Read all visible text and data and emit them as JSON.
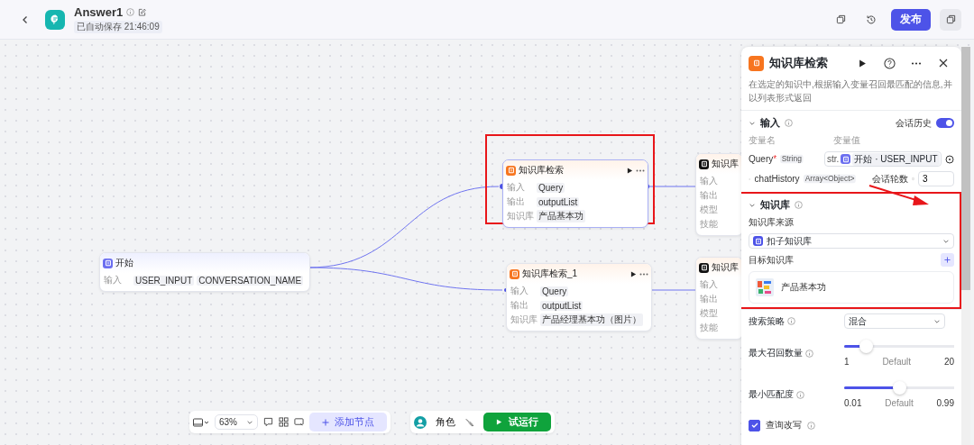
{
  "header": {
    "title": "Answer1",
    "save_status": "已自动保存 21:46:09",
    "publish": "发布"
  },
  "canvas": {
    "nodes": [
      {
        "kind": "start",
        "title": "开始",
        "highlighted": false,
        "rows": [
          {
            "label": "输入",
            "values": [
              "USER_INPUT",
              "CONVERSATION_NAME"
            ]
          }
        ]
      },
      {
        "kind": "knowledge",
        "title": "知识库检索",
        "highlighted": true,
        "rows": [
          {
            "label": "输入",
            "values": [
              "Query"
            ]
          },
          {
            "label": "输出",
            "values": [
              "outputList"
            ]
          },
          {
            "label": "知识库",
            "values": [
              "产品基本功"
            ]
          }
        ]
      },
      {
        "kind": "knowledge",
        "title": "知识库检索_1",
        "highlighted": false,
        "rows": [
          {
            "label": "输入",
            "values": [
              "Query"
            ]
          },
          {
            "label": "输出",
            "values": [
              "outputList"
            ]
          },
          {
            "label": "知识库",
            "values": [
              "产品经理基本功（图片）"
            ]
          }
        ]
      },
      {
        "kind": "llm",
        "title": "知识库",
        "highlighted": false,
        "rows": [
          {
            "label": "输入",
            "values": []
          },
          {
            "label": "输出",
            "values": []
          },
          {
            "label": "模型",
            "values": []
          },
          {
            "label": "技能",
            "values": []
          }
        ]
      },
      {
        "kind": "llm",
        "title": "知识库",
        "highlighted": false,
        "rows": [
          {
            "label": "输入",
            "values": []
          },
          {
            "label": "输出",
            "values": []
          },
          {
            "label": "模型",
            "values": []
          },
          {
            "label": "技能",
            "values": []
          }
        ]
      }
    ]
  },
  "toolbar": {
    "zoom": "63%",
    "add_node": "添加节点",
    "role": "角色",
    "run": "试运行"
  },
  "panel": {
    "title": "知识库检索",
    "description": "在选定的知识中,根据输入变量召回最匹配的信息,并以列表形式返回",
    "input": {
      "title": "输入",
      "history_label": "会话历史",
      "history_on": true,
      "name_header": "变量名",
      "value_header": "变量值",
      "query": {
        "name": "Query",
        "required_mark": "*",
        "type": "String",
        "prefix": "str.",
        "ref_node": "开始",
        "separator": "·",
        "ref_var": "USER_INPUT"
      },
      "chat_history": {
        "name": "chatHistory",
        "type": "Array<Object>",
        "rounds_label": "会话轮数",
        "rounds": "3"
      }
    },
    "knowledge": {
      "title": "知识库",
      "highlighted": true,
      "source_label": "知识库来源",
      "source": "扣子知识库",
      "target_label": "目标知识库",
      "items": [
        "产品基本功"
      ]
    },
    "strategy": {
      "label": "搜索策略",
      "value": "混合"
    },
    "sliders": [
      {
        "label": "最大召回数量",
        "level": 0.2,
        "min": "1",
        "default": "Default",
        "max": "20"
      },
      {
        "label": "最小匹配度",
        "level": 0.5,
        "min": "0.01",
        "default": "Default",
        "max": "0.99"
      }
    ],
    "rewrite": {
      "label": "查询改写",
      "checked": true
    }
  }
}
